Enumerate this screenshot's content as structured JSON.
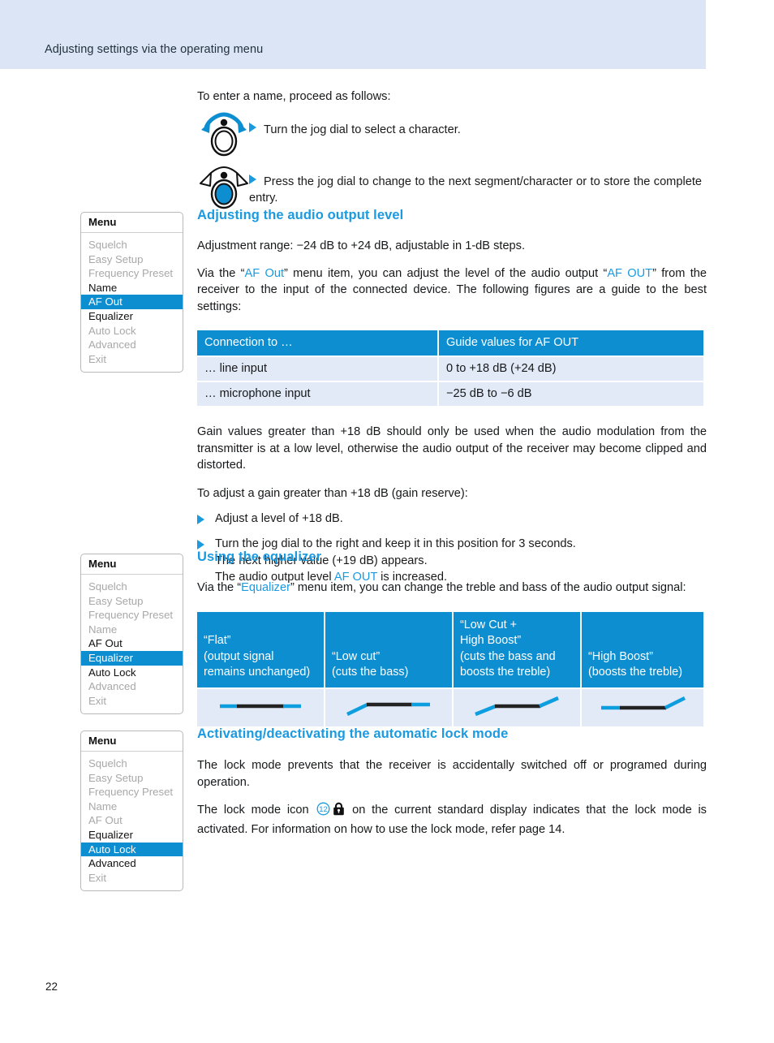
{
  "header": {
    "title": "Adjusting settings via the operating menu"
  },
  "footer": {
    "page_number": "22"
  },
  "colors": {
    "accent_blue": "#1b9ae0",
    "table_header_blue": "#0c8ed1",
    "header_band": "#dbe5f5",
    "table_cell": "#e3eaf7",
    "dim_text": "#a8a8a8"
  },
  "intro": {
    "lead": "To enter a name, proceed as follows:",
    "steps": [
      {
        "icon": "jog-dial-turn-icon",
        "text": "Turn the jog dial to select a character."
      },
      {
        "icon": "jog-dial-press-icon",
        "text": "Press the jog dial to change to the next segment/character or to store the complete entry."
      }
    ]
  },
  "sections": [
    {
      "id": "audio-output-level",
      "heading": "Adjusting the audio output level",
      "para_range": "Adjustment range: −24 dB to +24 dB, adjustable in 1-dB steps.",
      "para_via_pre": "Via the “",
      "para_via_link1": "AF Out",
      "para_via_mid": "” menu item, you can adjust the level of the audio output “",
      "para_via_link2": "AF OUT",
      "para_via_post": "” from the receiver to the input of the connected device. The following figures are a guide to the best settings:",
      "para_gain": "Gain values greater than +18 dB should only be used when the audio modulation from the transmitter is at a low level, otherwise the audio output of the receiver may become clipped and distorted.",
      "para_adjust": "To adjust a gain greater than +18 dB (gain reserve):",
      "bullets": [
        {
          "line1": "Adjust a level of +18 dB."
        },
        {
          "line1": "Turn the jog dial to the right and keep it in this position for 3 seconds.",
          "line2": "The next higher value (+19 dB) appears.",
          "line3_pre": "The audio output level ",
          "line3_link": "AF OUT",
          "line3_post": " is increased."
        }
      ]
    },
    {
      "id": "using-the-equalizer",
      "heading": "Using the equalizer",
      "para_via_pre": "Via the “",
      "para_via_link": "Equalizer",
      "para_via_post": "” menu item, you can change the treble and bass of the audio output signal:"
    },
    {
      "id": "automatic-lock-mode",
      "heading": "Activating/deactivating the automatic lock mode",
      "para_prevents": "The lock mode prevents that the receiver is accidentally switched off or programed during operation.",
      "para_icon_pre": "The lock mode icon ",
      "para_icon_badge": "12",
      "para_icon_post": " on the current standard display indicates that the lock mode is activated. For information on how to use the lock mode, refer page 14."
    }
  ],
  "af_out_table": {
    "headers": [
      "Connection to …",
      "Guide values for AF OUT"
    ],
    "rows": [
      [
        "… line input",
        "0 to +18 dB (+24 dB)"
      ],
      [
        "… microphone input",
        "−25 dB to −6 dB"
      ]
    ]
  },
  "equalizer_table": {
    "columns": [
      {
        "label_lines": [
          "“Flat”",
          "(output signal",
          "remains unchanged)"
        ],
        "curve": "flat"
      },
      {
        "label_lines": [
          "“Low cut”",
          "(cuts the bass)"
        ],
        "curve": "low-cut"
      },
      {
        "label_lines": [
          "“Low Cut +",
          "High Boost”",
          "(cuts the bass and",
          "boosts the treble)"
        ],
        "curve": "low-cut-high-boost"
      },
      {
        "label_lines": [
          "“High Boost”",
          "(boosts the treble)"
        ],
        "curve": "high-boost"
      }
    ]
  },
  "menus": [
    {
      "id": "menu-af-out",
      "title": "Menu",
      "items": [
        {
          "label": "Squelch",
          "state": "dim"
        },
        {
          "label": "Easy Setup",
          "state": "dim"
        },
        {
          "label": "Frequency Preset",
          "state": "dim"
        },
        {
          "label": "Name",
          "state": "norm"
        },
        {
          "label": "AF Out",
          "state": "sel"
        },
        {
          "label": "Equalizer",
          "state": "norm"
        },
        {
          "label": "Auto Lock",
          "state": "dim"
        },
        {
          "label": "Advanced",
          "state": "dim"
        },
        {
          "label": "Exit",
          "state": "dim"
        }
      ]
    },
    {
      "id": "menu-equalizer",
      "title": "Menu",
      "items": [
        {
          "label": "Squelch",
          "state": "dim"
        },
        {
          "label": "Easy Setup",
          "state": "dim"
        },
        {
          "label": "Frequency Preset",
          "state": "dim"
        },
        {
          "label": "Name",
          "state": "dim"
        },
        {
          "label": "AF Out",
          "state": "norm"
        },
        {
          "label": "Equalizer",
          "state": "sel"
        },
        {
          "label": "Auto Lock",
          "state": "norm"
        },
        {
          "label": "Advanced",
          "state": "dim"
        },
        {
          "label": "Exit",
          "state": "dim"
        }
      ]
    },
    {
      "id": "menu-auto-lock",
      "title": "Menu",
      "items": [
        {
          "label": "Squelch",
          "state": "dim"
        },
        {
          "label": "Easy Setup",
          "state": "dim"
        },
        {
          "label": "Frequency Preset",
          "state": "dim"
        },
        {
          "label": "Name",
          "state": "dim"
        },
        {
          "label": "AF Out",
          "state": "dim"
        },
        {
          "label": "Equalizer",
          "state": "norm"
        },
        {
          "label": "Auto Lock",
          "state": "sel"
        },
        {
          "label": "Advanced",
          "state": "norm"
        },
        {
          "label": "Exit",
          "state": "dim"
        }
      ]
    }
  ]
}
